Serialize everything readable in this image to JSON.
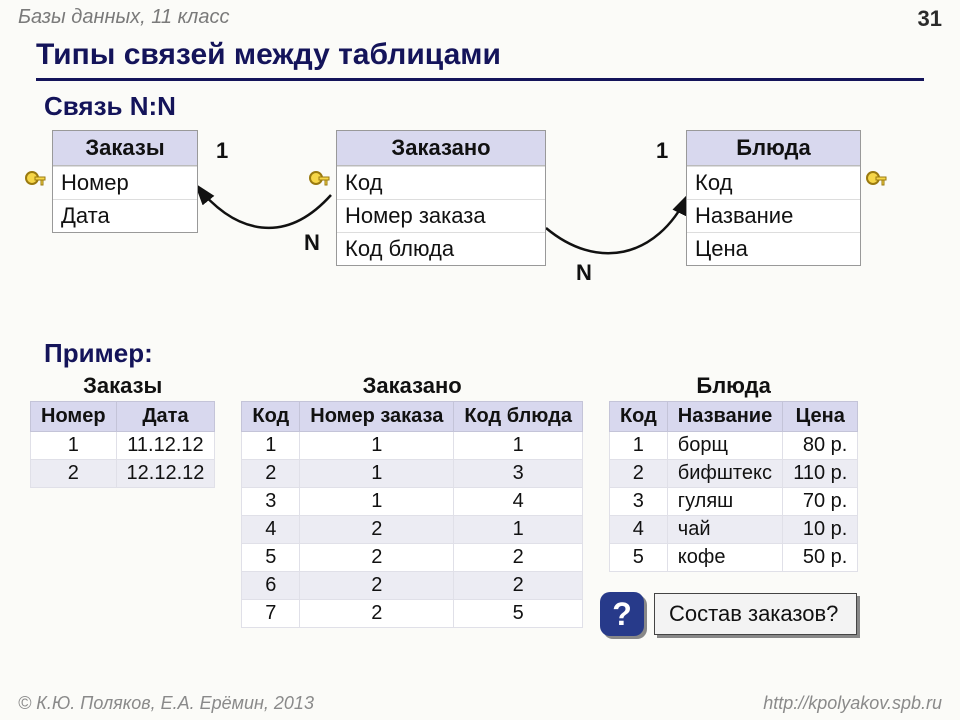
{
  "meta": {
    "course": "Базы данных, 11 класс",
    "page": "31",
    "copyright": "© К.Ю. Поляков, Е.А. Ерёмин, 2013",
    "url": "http://kpolyakov.spb.ru"
  },
  "title": "Типы связей между таблицами",
  "sub_relation": "Связь N:N",
  "sub_example": "Пример:",
  "entities": {
    "orders": {
      "name": "Заказы",
      "rows": [
        "Номер",
        "Дата"
      ],
      "key_row": 0
    },
    "ordered": {
      "name": "Заказано",
      "rows": [
        "Код",
        "Номер заказа",
        "Код блюда"
      ],
      "key_row": 0
    },
    "dishes": {
      "name": "Блюда",
      "rows": [
        "Код",
        "Название",
        "Цена"
      ],
      "key_row": 0
    }
  },
  "cardinality": {
    "one": "1",
    "many": "N"
  },
  "example": {
    "orders": {
      "title": "Заказы",
      "headers": [
        "Номер",
        "Дата"
      ],
      "rows": [
        [
          "1",
          "11.12.12"
        ],
        [
          "2",
          "12.12.12"
        ]
      ]
    },
    "ordered": {
      "title": "Заказано",
      "headers": [
        "Код",
        "Номер заказа",
        "Код блюда"
      ],
      "rows": [
        [
          "1",
          "1",
          "1"
        ],
        [
          "2",
          "1",
          "3"
        ],
        [
          "3",
          "1",
          "4"
        ],
        [
          "4",
          "2",
          "1"
        ],
        [
          "5",
          "2",
          "2"
        ],
        [
          "6",
          "2",
          "2"
        ],
        [
          "7",
          "2",
          "5"
        ]
      ]
    },
    "dishes": {
      "title": "Блюда",
      "headers": [
        "Код",
        "Название",
        "Цена"
      ],
      "rows": [
        [
          "1",
          "борщ",
          "80 р."
        ],
        [
          "2",
          "бифштекс",
          "110 р."
        ],
        [
          "3",
          "гуляш",
          "70 р."
        ],
        [
          "4",
          "чай",
          "10 р."
        ],
        [
          "5",
          "кофе",
          "50 р."
        ]
      ]
    }
  },
  "question": {
    "mark": "?",
    "text": "Состав заказов?"
  }
}
